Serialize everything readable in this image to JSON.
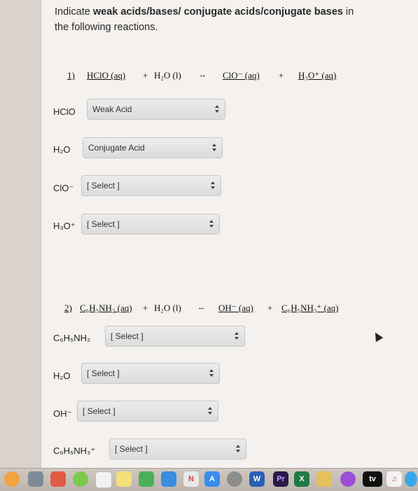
{
  "prompt": {
    "part1": "Indicate ",
    "bold": "weak acids/bases/ conjugate acids/conjugate bases",
    "part2": " in the following reactions."
  },
  "reaction1": {
    "number": "1)",
    "reactant1": "HClO (aq)",
    "plus1": "+",
    "reactant2": "H₂O (l)",
    "arrow": "↔",
    "product1": "ClO⁻ (aq)",
    "plus2": "+",
    "product2": "H₃O⁺ (aq)"
  },
  "questions1": [
    {
      "label": "HClO",
      "selected": "Weak Acid"
    },
    {
      "label": "H₂O",
      "selected": "Conjugate Acid"
    },
    {
      "label": "ClO⁻",
      "selected": "[ Select ]"
    },
    {
      "label": "H₃O⁺",
      "selected": "[ Select ]"
    }
  ],
  "reaction2": {
    "number": "2)",
    "reactant1": "C₆H₅NH₂ (aq)",
    "plus1": "+",
    "reactant2": "H₂O (l)",
    "arrow": "↔",
    "product1": "OH⁻ (aq)",
    "plus2": "+",
    "product2": "C₆H₅NH₃⁺ (aq)"
  },
  "questions2": [
    {
      "label": "C₆H₅NH₂",
      "selected": "[ Select ]"
    },
    {
      "label": "H₂O",
      "selected": "[ Select ]"
    },
    {
      "label": "OH⁻",
      "selected": "[ Select ]"
    },
    {
      "label": "C₆H₅NH₃⁺",
      "selected": "[ Select ]"
    }
  ],
  "dock": {
    "icons": [
      "finder-icon",
      "launchpad-icon",
      "chrome-icon",
      "messages-icon",
      "notes-icon",
      "numbers-icon",
      "photos-icon",
      "news-icon",
      "app-store-icon",
      "settings-icon",
      "word-icon",
      "premiere-icon",
      "excel-icon",
      "photos-app-icon",
      "podcasts-icon",
      "tv-icon",
      "music-icon"
    ],
    "word_label": "W",
    "premiere_label": "Pr",
    "excel_label": "X",
    "tv_label": "tv"
  }
}
